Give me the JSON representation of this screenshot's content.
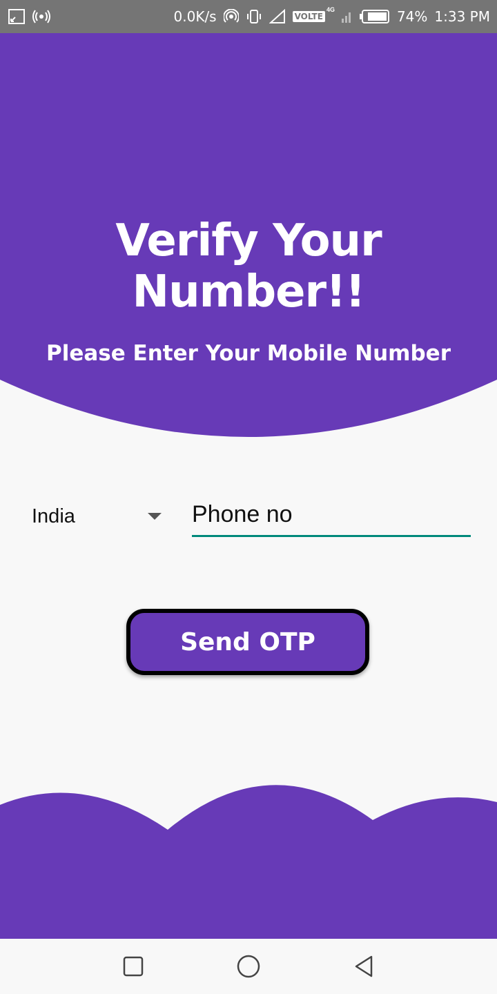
{
  "status_bar": {
    "speed": "0.0K/s",
    "volte": "VOLTE",
    "network": "4G",
    "battery": "74%",
    "time": "1:33 PM",
    "icons": [
      "screen-cast-icon",
      "wifi-hotspot-icon",
      "hotspot-icon",
      "vibrate-icon",
      "signal-icon",
      "battery-icon"
    ]
  },
  "header": {
    "title": "Verify Your Number!!",
    "subtitle": "Please Enter Your Mobile Number"
  },
  "form": {
    "country": "India",
    "phone_placeholder": "Phone no",
    "phone_value": "",
    "send_button": "Send OTP"
  },
  "nav_bar": {
    "icons": [
      "recents-square-icon",
      "home-circle-icon",
      "back-triangle-icon"
    ]
  },
  "colors": {
    "primary": "#673ab7",
    "accent": "#00897b",
    "status_bar": "#757575",
    "background": "#f8f8f8"
  }
}
